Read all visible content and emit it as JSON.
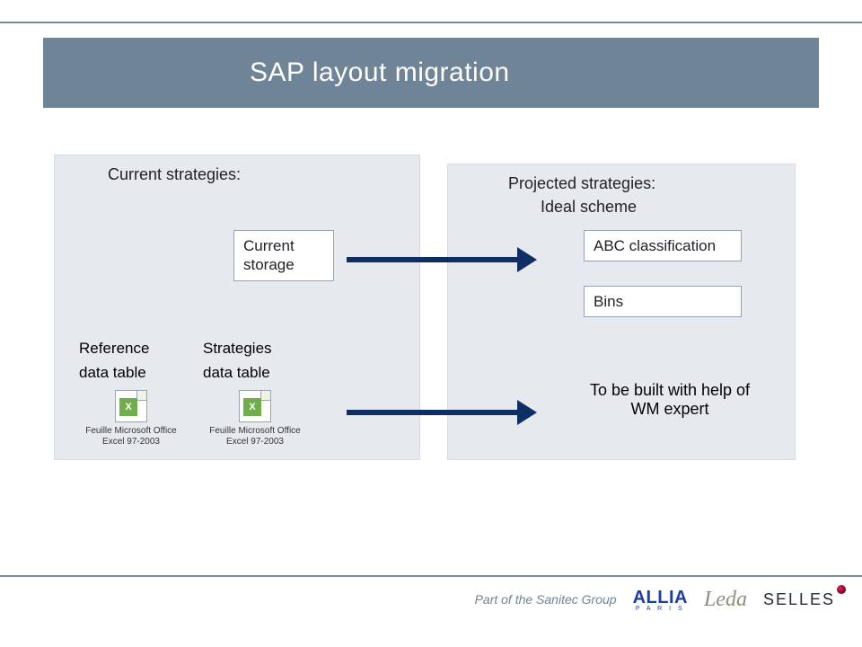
{
  "title": "SAP layout migration",
  "left_panel": {
    "heading": "Current strategies:",
    "current_storage": "Current storage",
    "reference_label_line1": "Reference",
    "reference_label_line2": "data table",
    "strategies_label_line1": "Strategies",
    "strategies_label_line2": "data table",
    "embed_caption": "Feuille Microsoft Office Excel 97-2003"
  },
  "right_panel": {
    "heading": "Projected strategies:",
    "subheading": "Ideal scheme",
    "abc": "ABC classification",
    "bins": "Bins",
    "note": "To be built with help of WM expert"
  },
  "footer": {
    "sanitec": "Part of the Sanitec Group",
    "allia": "ALLIA",
    "allia_sub": "P A R I S",
    "leda": "Leda",
    "selles": "SELLES"
  }
}
